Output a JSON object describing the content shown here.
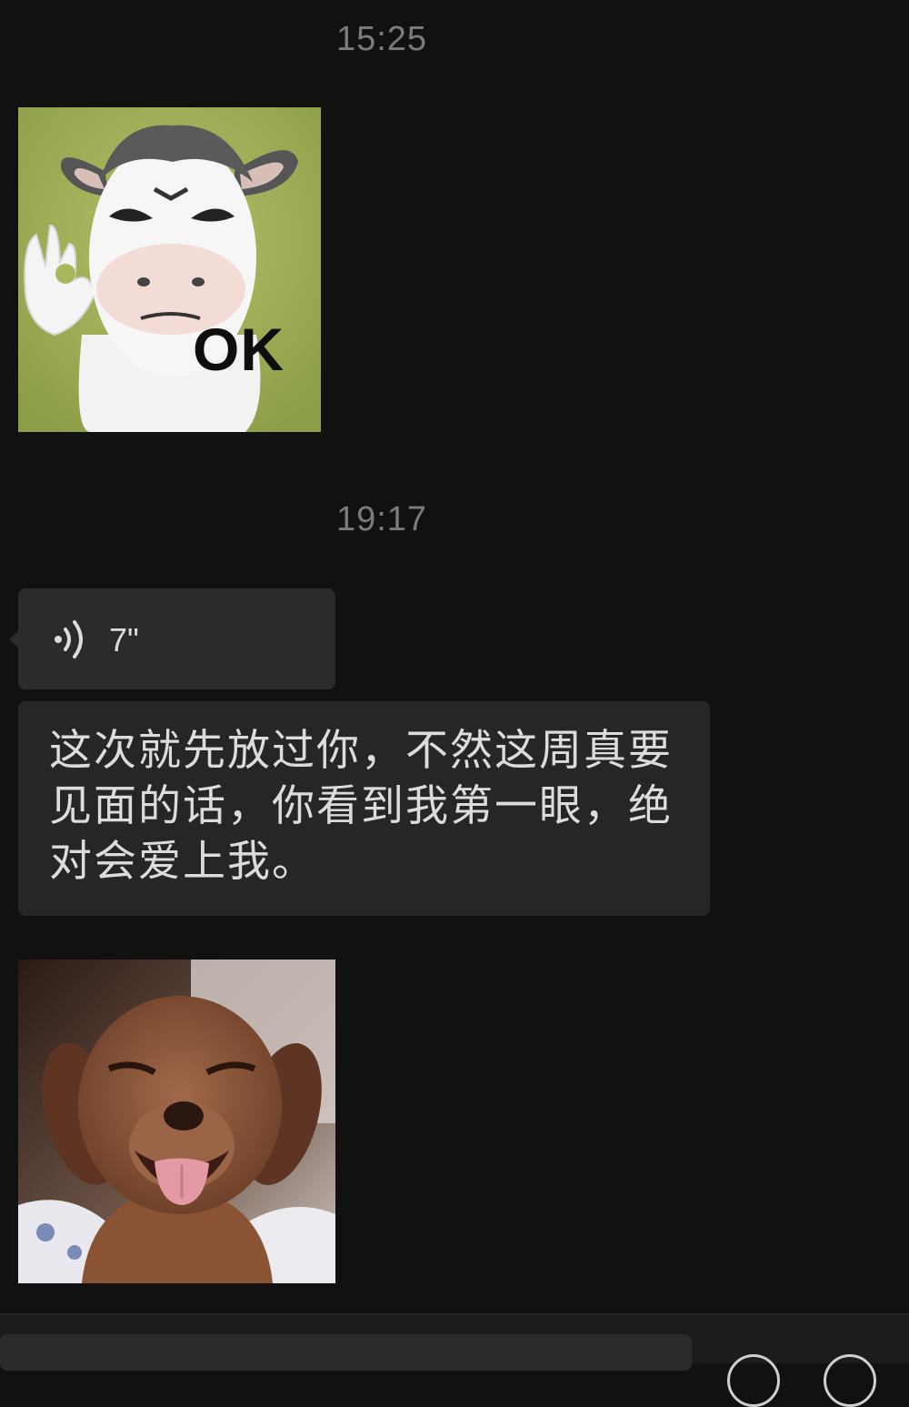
{
  "chat": {
    "timestamp_1": "15:25",
    "timestamp_2": "19:17",
    "sticker_1": {
      "icon": "cow-ok-sticker",
      "caption": "OK"
    },
    "voice_message": {
      "duration": "7\"",
      "icon": "voice-wave-icon"
    },
    "text_message": "这次就先放过你，不然这周真要见面的话，你看到我第一眼，绝对会爱上我。",
    "sticker_2": {
      "icon": "laughing-dog-sticker"
    }
  },
  "input_bar": {
    "emoji_icon": "emoji-icon",
    "more_icon": "plus-icon"
  },
  "colors": {
    "background": "#111111",
    "bubble": "#2b2b2b",
    "timestamp": "#7b7b7b",
    "text": "#dcdcdc"
  }
}
